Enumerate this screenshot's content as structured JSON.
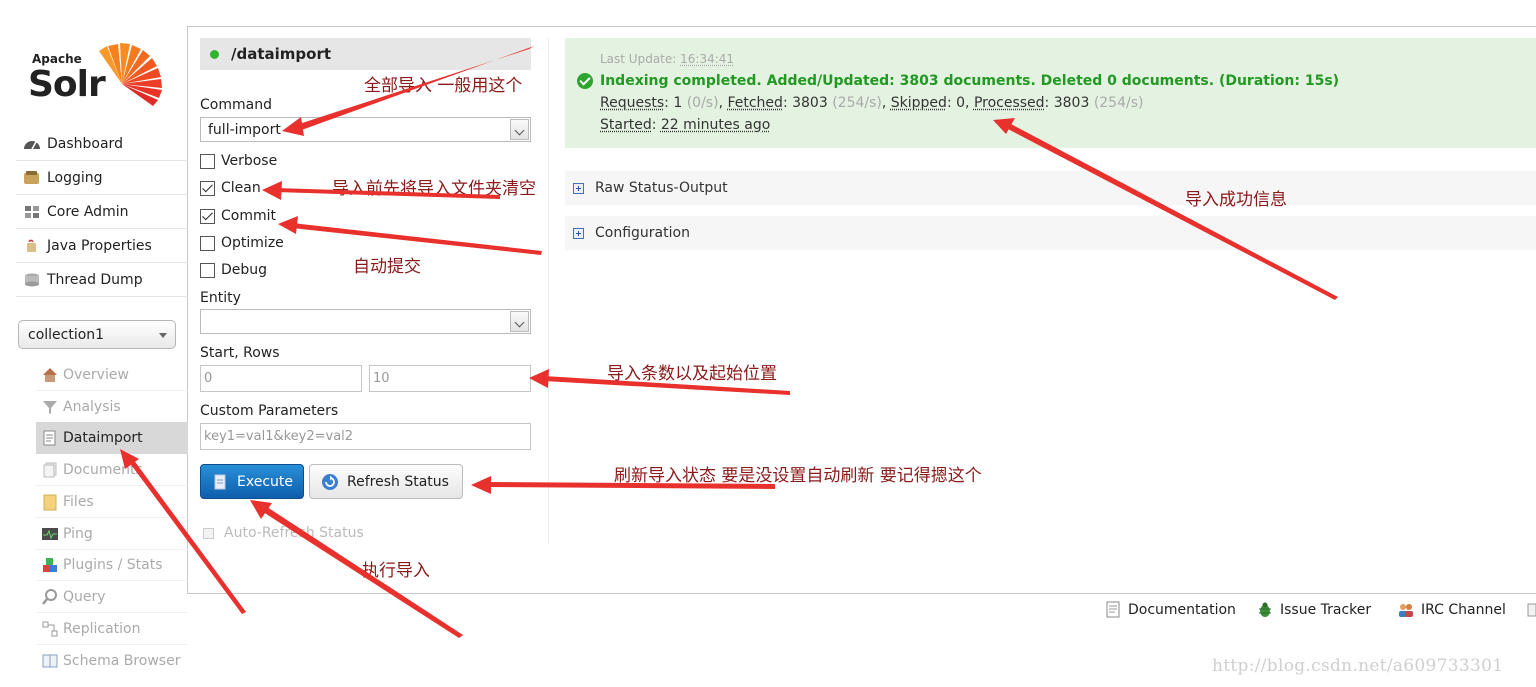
{
  "logo": {
    "top": "Apache",
    "main": "Solr"
  },
  "nav": [
    {
      "label": "Dashboard",
      "icon": "dashboard-icon"
    },
    {
      "label": "Logging",
      "icon": "logging-icon"
    },
    {
      "label": "Core Admin",
      "icon": "core-admin-icon"
    },
    {
      "label": "Java Properties",
      "icon": "java-icon"
    },
    {
      "label": "Thread Dump",
      "icon": "thread-dump-icon"
    }
  ],
  "core_selector": {
    "value": "collection1"
  },
  "core_menu": [
    {
      "label": "Overview",
      "active": false
    },
    {
      "label": "Analysis",
      "active": false
    },
    {
      "label": "Dataimport",
      "active": true
    },
    {
      "label": "Documents",
      "active": false
    },
    {
      "label": "Files",
      "active": false
    },
    {
      "label": "Ping",
      "active": false
    },
    {
      "label": "Plugins / Stats",
      "active": false
    },
    {
      "label": "Query",
      "active": false
    },
    {
      "label": "Replication",
      "active": false
    },
    {
      "label": "Schema Browser",
      "active": false
    }
  ],
  "dataimport": {
    "handler": "/dataimport",
    "command_label": "Command",
    "command_value": "full-import",
    "options": [
      {
        "label": "Verbose",
        "checked": false
      },
      {
        "label": "Clean",
        "checked": true
      },
      {
        "label": "Commit",
        "checked": true
      },
      {
        "label": "Optimize",
        "checked": false
      },
      {
        "label": "Debug",
        "checked": false
      }
    ],
    "entity_label": "Entity",
    "entity_value": "",
    "start_rows_label": "Start, Rows",
    "start_placeholder": "0",
    "rows_placeholder": "10",
    "custom_params_label": "Custom Parameters",
    "custom_params_placeholder": "key1=val1&key2=val2",
    "execute_label": "Execute",
    "refresh_label": "Refresh Status",
    "auto_refresh_label": "Auto-Refresh Status"
  },
  "status": {
    "last_update_label": "Last Update:",
    "last_update_time": "16:34:41",
    "message": "Indexing completed. Added/Updated: 3803 documents. Deleted 0 documents. (Duration: 15s)",
    "requests_label": "Requests",
    "requests_value": "1",
    "requests_rate": "(0/s)",
    "fetched_label": "Fetched",
    "fetched_value": "3803",
    "fetched_rate": "(254/s)",
    "skipped_label": "Skipped",
    "skipped_value": "0",
    "processed_label": "Processed",
    "processed_value": "3803",
    "processed_rate": "(254/s)",
    "started_label": "Started",
    "started_value": "22 minutes ago"
  },
  "panels": {
    "raw_status": "Raw Status-Output",
    "configuration": "Configuration"
  },
  "footer": {
    "documentation": "Documentation",
    "issue_tracker": "Issue Tracker",
    "irc_channel": "IRC Channel"
  },
  "annotations": {
    "full_import": "全部导入 一般用这个",
    "clean": "导入前先将导入文件夹清空",
    "commit": "自动提交",
    "start_rows": "导入条数以及起始位置",
    "refresh": "刷新导入状态 要是没设置自动刷新 要记得摁这个",
    "execute": "执行导入",
    "success": "导入成功信息"
  },
  "watermark": "http://blog.csdn.net/a609733301",
  "colors": {
    "annotation_red": "#e8302c",
    "status_green": "#229922",
    "status_bg": "#e4f2e1",
    "execute_blue": "#1a73c4"
  }
}
